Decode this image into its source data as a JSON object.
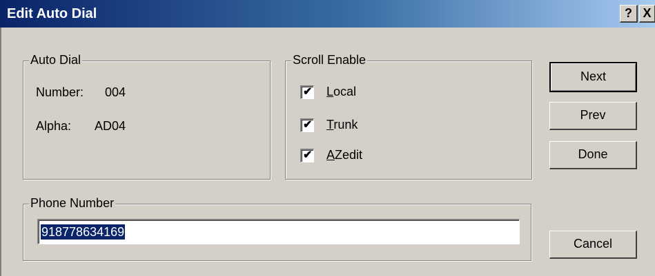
{
  "window": {
    "title": "Edit Auto Dial",
    "help_button": "?",
    "close_button": "X"
  },
  "auto_dial": {
    "legend": "Auto Dial",
    "number_label": "Number:",
    "number_value": "004",
    "alpha_label": "Alpha:",
    "alpha_value": "AD04"
  },
  "scroll_enable": {
    "legend": "Scroll Enable",
    "items": [
      {
        "label_mnemonic": "L",
        "label_rest": "ocal",
        "checked": true
      },
      {
        "label_mnemonic": "T",
        "label_rest": "runk",
        "checked": true
      },
      {
        "label_mnemonic": "A",
        "label_rest": "Zedit",
        "checked": true
      }
    ],
    "check_glyph": "✔"
  },
  "phone_number": {
    "legend": "Phone Number",
    "value": "918778634169"
  },
  "buttons": {
    "next": "Next",
    "prev": "Prev",
    "done": "Done",
    "cancel": "Cancel"
  },
  "colors": {
    "titlebar_start": "#0a246a",
    "titlebar_end": "#a6caf0",
    "dialog_face": "#d4d0c8",
    "selection": "#0a246a"
  }
}
